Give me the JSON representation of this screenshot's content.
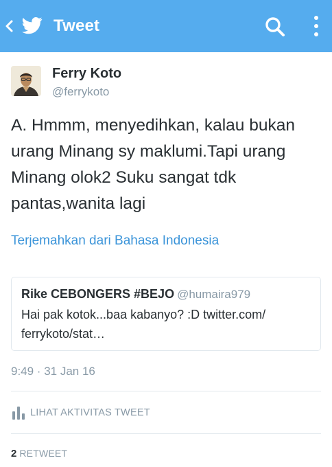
{
  "app_bar": {
    "title": "Tweet",
    "bg_color": "#55acee",
    "icons": [
      "back-chevron-icon",
      "twitter-bird-icon",
      "search-icon",
      "more-vertical-icon"
    ]
  },
  "tweet": {
    "author_name": "Ferry Koto",
    "author_handle": "@ferrykoto",
    "text": "A. Hmmm, menyedihkan, kalau bukan urang Minang sy maklumi.Tapi urang Minang olok2 Suku sangat tdk pantas,wanita lagi",
    "translate_link": "Terjemahkan dari Bahasa Indonesia",
    "timestamp": "9:49 · 31 Jan 16"
  },
  "quoted_tweet": {
    "author_name": "Rike CEBONGERS #BEJO",
    "author_handle": "@humaira979",
    "text": "Hai pak kotok...baa kabanyo? :D twitter.com/ ferrykoto/stat…"
  },
  "activity": {
    "label": "LIHAT AKTIVITAS TWEET",
    "icon": "bar-chart-icon"
  },
  "retweets": {
    "count": "2",
    "label": "RETWEET"
  },
  "colors": {
    "link": "#3b94d9",
    "muted": "#8899a6",
    "text": "#292f33",
    "divider": "#e1e8ed"
  }
}
